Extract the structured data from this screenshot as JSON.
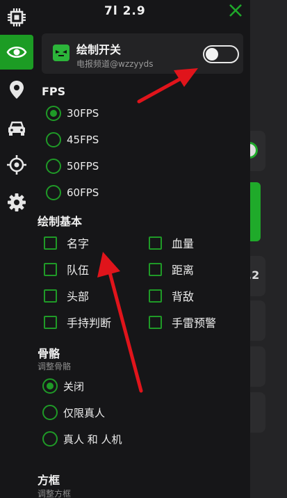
{
  "header": {
    "title": "7l 2.9"
  },
  "rail": {
    "items": [
      "chip-icon",
      "eye-icon",
      "location-pin-icon",
      "car-icon",
      "crosshair-icon",
      "gear-icon"
    ],
    "active": "eye-icon"
  },
  "card": {
    "title": "绘制开关",
    "subtitle": "电报频道@wzzyyds",
    "toggle_on": false
  },
  "fps": {
    "heading": "FPS",
    "options": [
      "30FPS",
      "45FPS",
      "50FPS",
      "60FPS"
    ],
    "selected": "30FPS"
  },
  "draw_basic": {
    "heading": "绘制基本",
    "left": [
      "名字",
      "队伍",
      "头部",
      "手持判断"
    ],
    "right": [
      "血量",
      "距离",
      "背敌",
      "手雷预警"
    ]
  },
  "skeleton": {
    "heading": "骨骼",
    "subtitle": "调整骨骼",
    "options": [
      "关闭",
      "仅限真人",
      "真人 和 人机"
    ],
    "selected": "关闭"
  },
  "box": {
    "heading": "方框",
    "subtitle": "调整方框"
  },
  "background": {
    "partial_text": ".2"
  },
  "colors": {
    "accent": "#1f9a27",
    "panel": "#161618",
    "arrow": "#e0141b"
  }
}
